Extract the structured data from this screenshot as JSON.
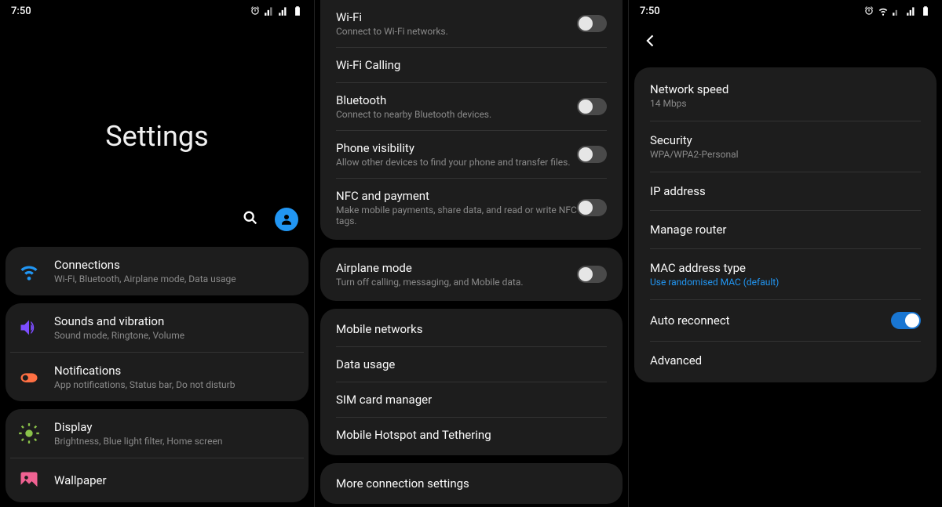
{
  "status": {
    "time": "7:50"
  },
  "screen1": {
    "title": "Settings",
    "groups": [
      {
        "rows": [
          {
            "title": "Connections",
            "sub": "Wi-Fi, Bluetooth, Airplane mode, Data usage",
            "icon": "wifi",
            "color": "#2196f3"
          }
        ]
      },
      {
        "rows": [
          {
            "title": "Sounds and vibration",
            "sub": "Sound mode, Ringtone, Volume",
            "icon": "sound",
            "color": "#7c4dff"
          },
          {
            "title": "Notifications",
            "sub": "App notifications, Status bar, Do not disturb",
            "icon": "notif",
            "color": "#ff7043"
          }
        ]
      },
      {
        "rows": [
          {
            "title": "Display",
            "sub": "Brightness, Blue light filter, Home screen",
            "icon": "display",
            "color": "#8bc34a"
          },
          {
            "title": "Wallpaper",
            "sub": "",
            "icon": "wallpaper",
            "color": "#f06292"
          }
        ]
      }
    ]
  },
  "screen2": {
    "group1": [
      {
        "title": "Wi-Fi",
        "sub": "Connect to Wi-Fi networks.",
        "toggle": false
      },
      {
        "title": "Wi-Fi Calling",
        "sub": ""
      },
      {
        "title": "Bluetooth",
        "sub": "Connect to nearby Bluetooth devices.",
        "toggle": false
      },
      {
        "title": "Phone visibility",
        "sub": "Allow other devices to find your phone and transfer files.",
        "toggle": false
      },
      {
        "title": "NFC and payment",
        "sub": "Make mobile payments, share data, and read or write NFC tags.",
        "toggle": false
      }
    ],
    "group2": [
      {
        "title": "Airplane mode",
        "sub": "Turn off calling, messaging, and Mobile data.",
        "toggle": false
      }
    ],
    "group3": [
      {
        "title": "Mobile networks"
      },
      {
        "title": "Data usage"
      },
      {
        "title": "SIM card manager"
      },
      {
        "title": "Mobile Hotspot and Tethering"
      }
    ],
    "group4": [
      {
        "title": "More connection settings"
      }
    ]
  },
  "screen3": {
    "rows": [
      {
        "title": "Network speed",
        "sub": "14 Mbps"
      },
      {
        "title": "Security",
        "sub": "WPA/WPA2-Personal"
      },
      {
        "title": "IP address",
        "sub": ""
      },
      {
        "title": "Manage router",
        "sub": ""
      },
      {
        "title": "MAC address type",
        "sub": "Use randomised MAC (default)",
        "accent": true
      },
      {
        "title": "Auto reconnect",
        "sub": "",
        "toggle": true
      },
      {
        "title": "Advanced",
        "sub": ""
      }
    ]
  }
}
